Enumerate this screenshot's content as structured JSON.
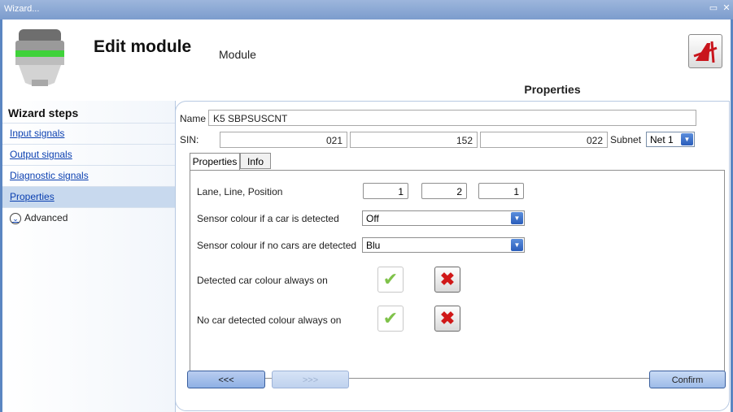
{
  "window": {
    "title": "Wizard...",
    "restore_icon": "restore-icon",
    "close_icon": "close-icon"
  },
  "header": {
    "title": "Edit module",
    "subtitle": "Module",
    "tab_label": "Properties"
  },
  "sidebar": {
    "title": "Wizard steps",
    "items": [
      {
        "label": "Input signals"
      },
      {
        "label": "Output signals"
      },
      {
        "label": "Diagnostic signals"
      },
      {
        "label": "Properties",
        "active": true
      },
      {
        "label": "Advanced"
      }
    ]
  },
  "form": {
    "name_label": "Name",
    "name_value": "K5 SBPSUSCNT",
    "sin_label": "SIN:",
    "sin_values": [
      "021",
      "152",
      "022"
    ],
    "subnet_label": "Subnet",
    "subnet_value": "Net 1"
  },
  "inner_tabs": {
    "properties": "Properties",
    "info": "Info"
  },
  "properties": {
    "lane_label": "Lane, Line, Position",
    "lane_values": [
      "1",
      "2",
      "1"
    ],
    "detected_colour_label": "Sensor colour if a car is detected",
    "detected_colour_value": "Off",
    "no_car_colour_label": "Sensor colour if no cars are detected",
    "no_car_colour_value": "Blu",
    "detected_always_on_label": "Detected car colour always on",
    "no_car_always_on_label": "No car detected colour always on"
  },
  "buttons": {
    "prev": "<<<",
    "next": ">>>",
    "confirm": "Confirm"
  }
}
